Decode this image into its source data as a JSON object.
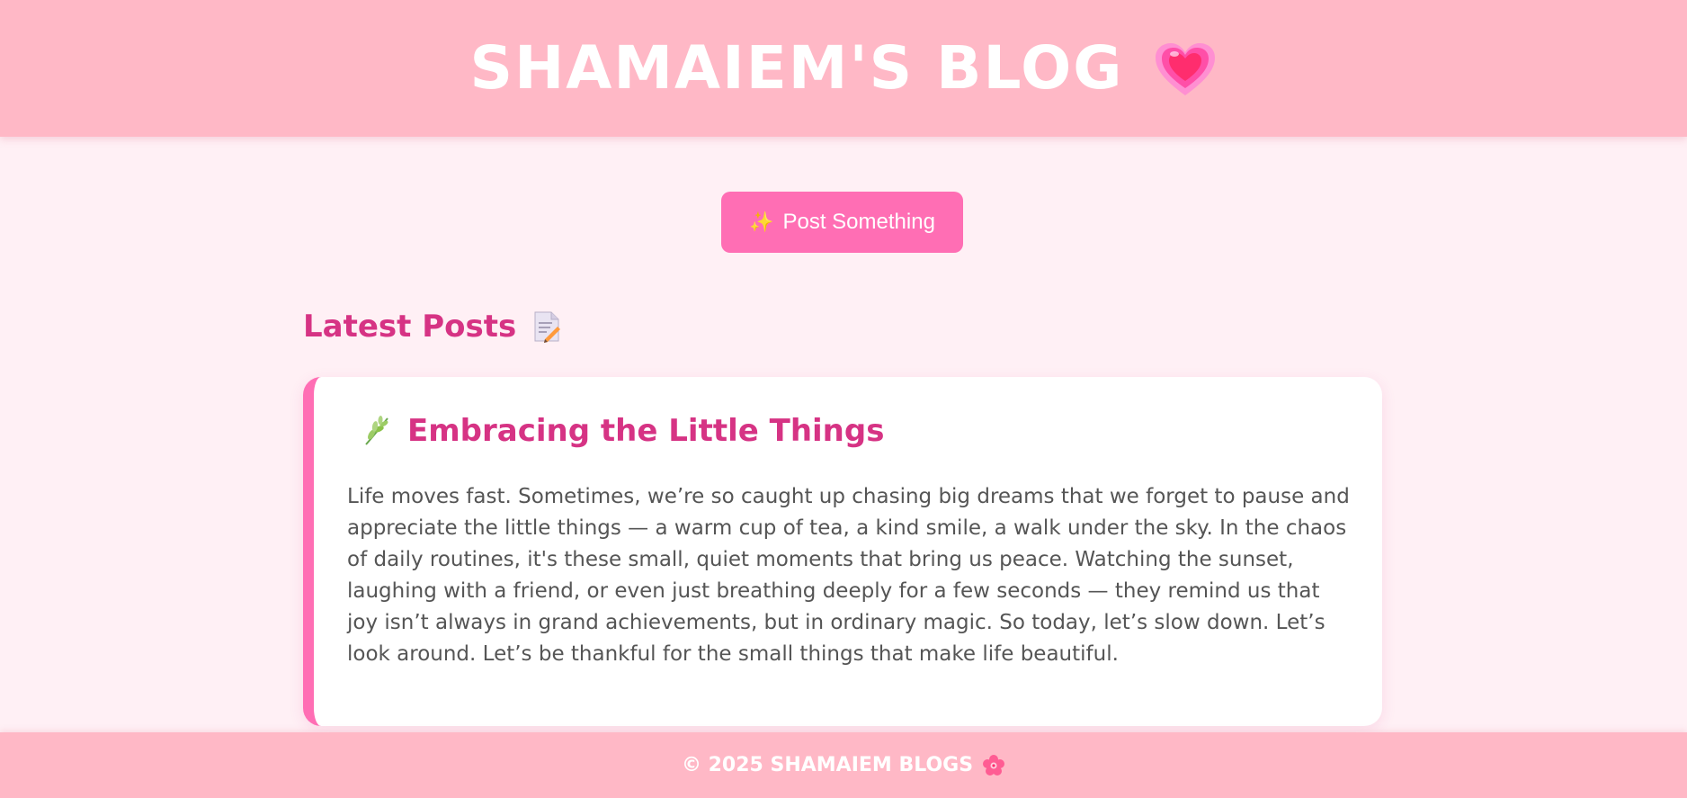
{
  "header": {
    "title": "SHAMAIEM'S BLOG",
    "icon": "heart-icon"
  },
  "actions": {
    "post_button_icon": "✨",
    "post_button_label": "Post Something"
  },
  "main": {
    "section_title": "Latest Posts",
    "section_icon": "memo-icon",
    "posts": [
      {
        "icon": "leaf-icon",
        "title": "Embracing the Little Things",
        "body": "Life moves fast. Sometimes, we’re so caught up chasing big dreams that we forget to pause and appreciate the little things — a warm cup of tea, a kind smile, a walk under the sky. In the chaos of daily routines, it's these small, quiet moments that bring us peace. Watching the sunset, laughing with a friend, or even just breathing deeply for a few seconds — they remind us that joy isn’t always in grand achievements, but in ordinary magic. So today, let’s slow down. Let’s look around. Let’s be thankful for the small things that make life beautiful."
      }
    ]
  },
  "footer": {
    "text": "© 2025 SHAMAIEM BLOGS",
    "icon": "blossom-icon"
  },
  "colors": {
    "header_bg": "#ffb8c6",
    "page_bg": "#fff0f5",
    "accent": "#ff6eb4",
    "title_pink": "#d63384",
    "body_text": "#555555"
  }
}
